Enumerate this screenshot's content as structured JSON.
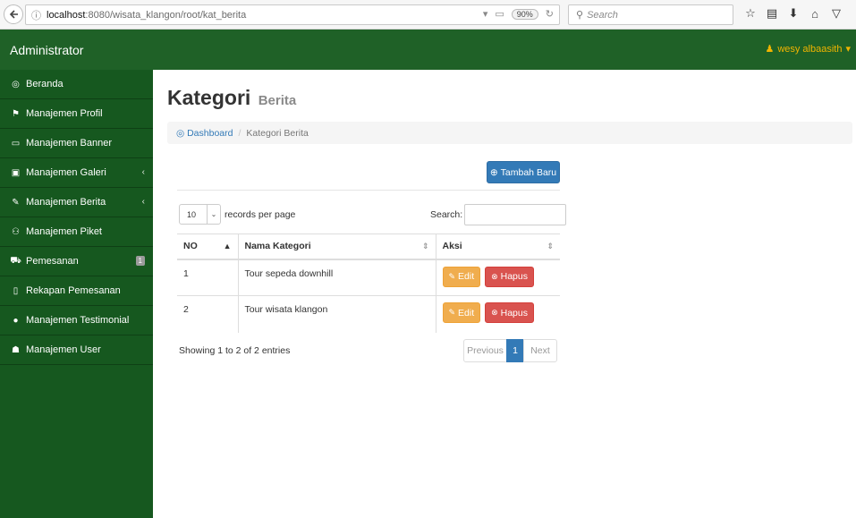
{
  "browser": {
    "url_host": "localhost",
    "url_path": ":8080/wisata_klangon/root/kat_berita",
    "zoom": "90%",
    "search_placeholder": "Search"
  },
  "header": {
    "brand": "Administrator",
    "user": "wesy albaasith"
  },
  "sidebar": {
    "items": [
      {
        "label": "Beranda",
        "icon": "dashboard-icon"
      },
      {
        "label": "Manajemen Profil",
        "icon": "flag-icon"
      },
      {
        "label": "Manajemen Banner",
        "icon": "monitor-icon"
      },
      {
        "label": "Manajemen Galeri",
        "icon": "image-icon"
      },
      {
        "label": "Manajemen Berita",
        "icon": "pencil-icon"
      },
      {
        "label": "Manajemen Piket",
        "icon": "users-icon"
      },
      {
        "label": "Pemesanan",
        "icon": "cart-icon",
        "badge": "1"
      },
      {
        "label": "Rekapan Pemesanan",
        "icon": "file-icon"
      },
      {
        "label": "Manajemen Testimonial",
        "icon": "comment-icon"
      },
      {
        "label": "Manajemen User",
        "icon": "group-icon"
      }
    ]
  },
  "page": {
    "title": "Kategori",
    "subtitle": "Berita",
    "breadcrumb": {
      "home": "Dashboard",
      "current": "Kategori Berita"
    },
    "add_button": "Tambah Baru"
  },
  "datatable": {
    "page_length": "10",
    "length_label": "records per page",
    "search_label": "Search:",
    "columns": [
      "NO",
      "Nama Kategori",
      "Aksi"
    ],
    "rows": [
      {
        "no": "1",
        "name": "Tour sepeda downhill"
      },
      {
        "no": "2",
        "name": "Tour wisata klangon"
      }
    ],
    "edit_label": "Edit",
    "delete_label": "Hapus",
    "info": "Showing 1 to 2 of 2 entries",
    "pager": {
      "prev": "Previous",
      "current": "1",
      "next": "Next"
    }
  },
  "colors": {
    "header_green": "#1f6127",
    "sidebar_green": "#16581f",
    "primary": "#337ab7",
    "warning": "#f0ad4e",
    "danger": "#d9534f",
    "user_accent": "#f0b400"
  }
}
